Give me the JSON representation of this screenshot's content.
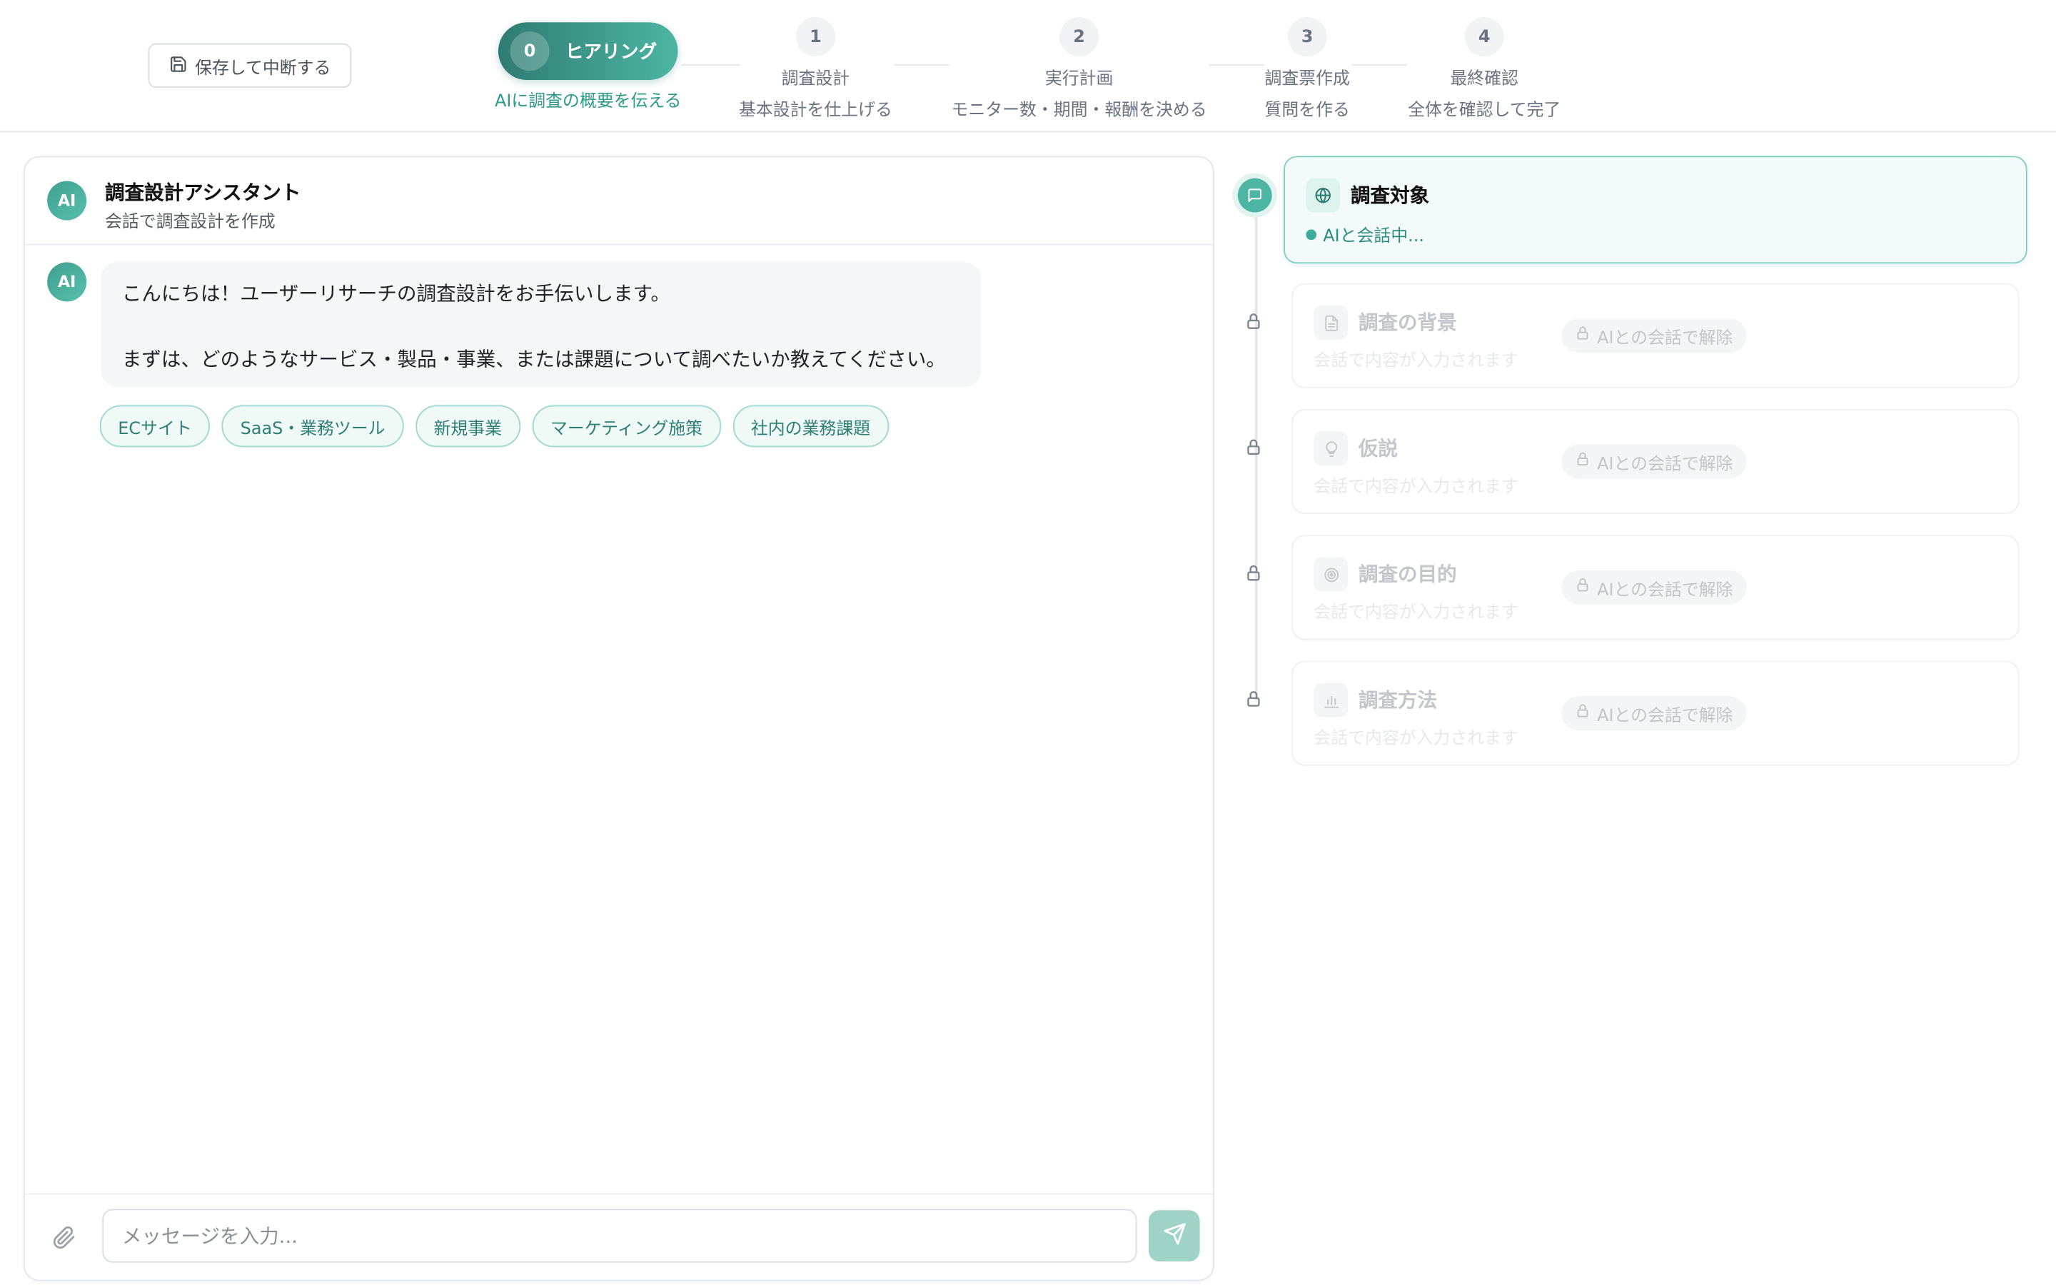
{
  "header": {
    "save_button": "保存して中断する",
    "steps": [
      {
        "num": "0",
        "title": "ヒアリング",
        "sub": "AIに調査の概要を伝える",
        "active": true
      },
      {
        "num": "1",
        "title": "調査設計",
        "sub": "基本設計を仕上げる"
      },
      {
        "num": "2",
        "title": "実行計画",
        "sub": "モニター数・期間・報酬を決める"
      },
      {
        "num": "3",
        "title": "調査票作成",
        "sub": "質問を作る"
      },
      {
        "num": "4",
        "title": "最終確認",
        "sub": "全体を確認して完了"
      }
    ]
  },
  "chat": {
    "avatar_label": "AI",
    "title": "調査設計アシスタント",
    "subtitle": "会話で調査設計を作成",
    "messages": [
      {
        "sender": "AI",
        "line1": "こんにちは！ユーザーリサーチの調査設計をお手伝いします。",
        "line2": "まずは、どのようなサービス・製品・事業、または課題について調べたいか教えてください。"
      }
    ],
    "suggestions": [
      "ECサイト",
      "SaaS・業務ツール",
      "新規事業",
      "マーケティング施策",
      "社内の業務課題"
    ],
    "input_placeholder": "メッセージを入力..."
  },
  "sections": [
    {
      "title": "調査対象",
      "status": "AIと会話中...",
      "icon": "globe-icon",
      "active": true
    },
    {
      "title": "調査の背景",
      "desc": "会話で内容が入力されます",
      "badge": "AIとの会話で解除",
      "icon": "document-icon"
    },
    {
      "title": "仮説",
      "desc": "会話で内容が入力されます",
      "badge": "AIとの会話で解除",
      "icon": "lightbulb-icon"
    },
    {
      "title": "調査の目的",
      "desc": "会話で内容が入力されます",
      "badge": "AIとの会話で解除",
      "icon": "target-icon"
    },
    {
      "title": "調査方法",
      "desc": "会話で内容が入力されます",
      "badge": "AIとの会話で解除",
      "icon": "bar-chart-icon"
    }
  ],
  "colors": {
    "accent": "#4db6a3",
    "accent_dark": "#2f7b72",
    "chip_border": "#9fd8cd",
    "chip_bg": "#effaf7"
  }
}
